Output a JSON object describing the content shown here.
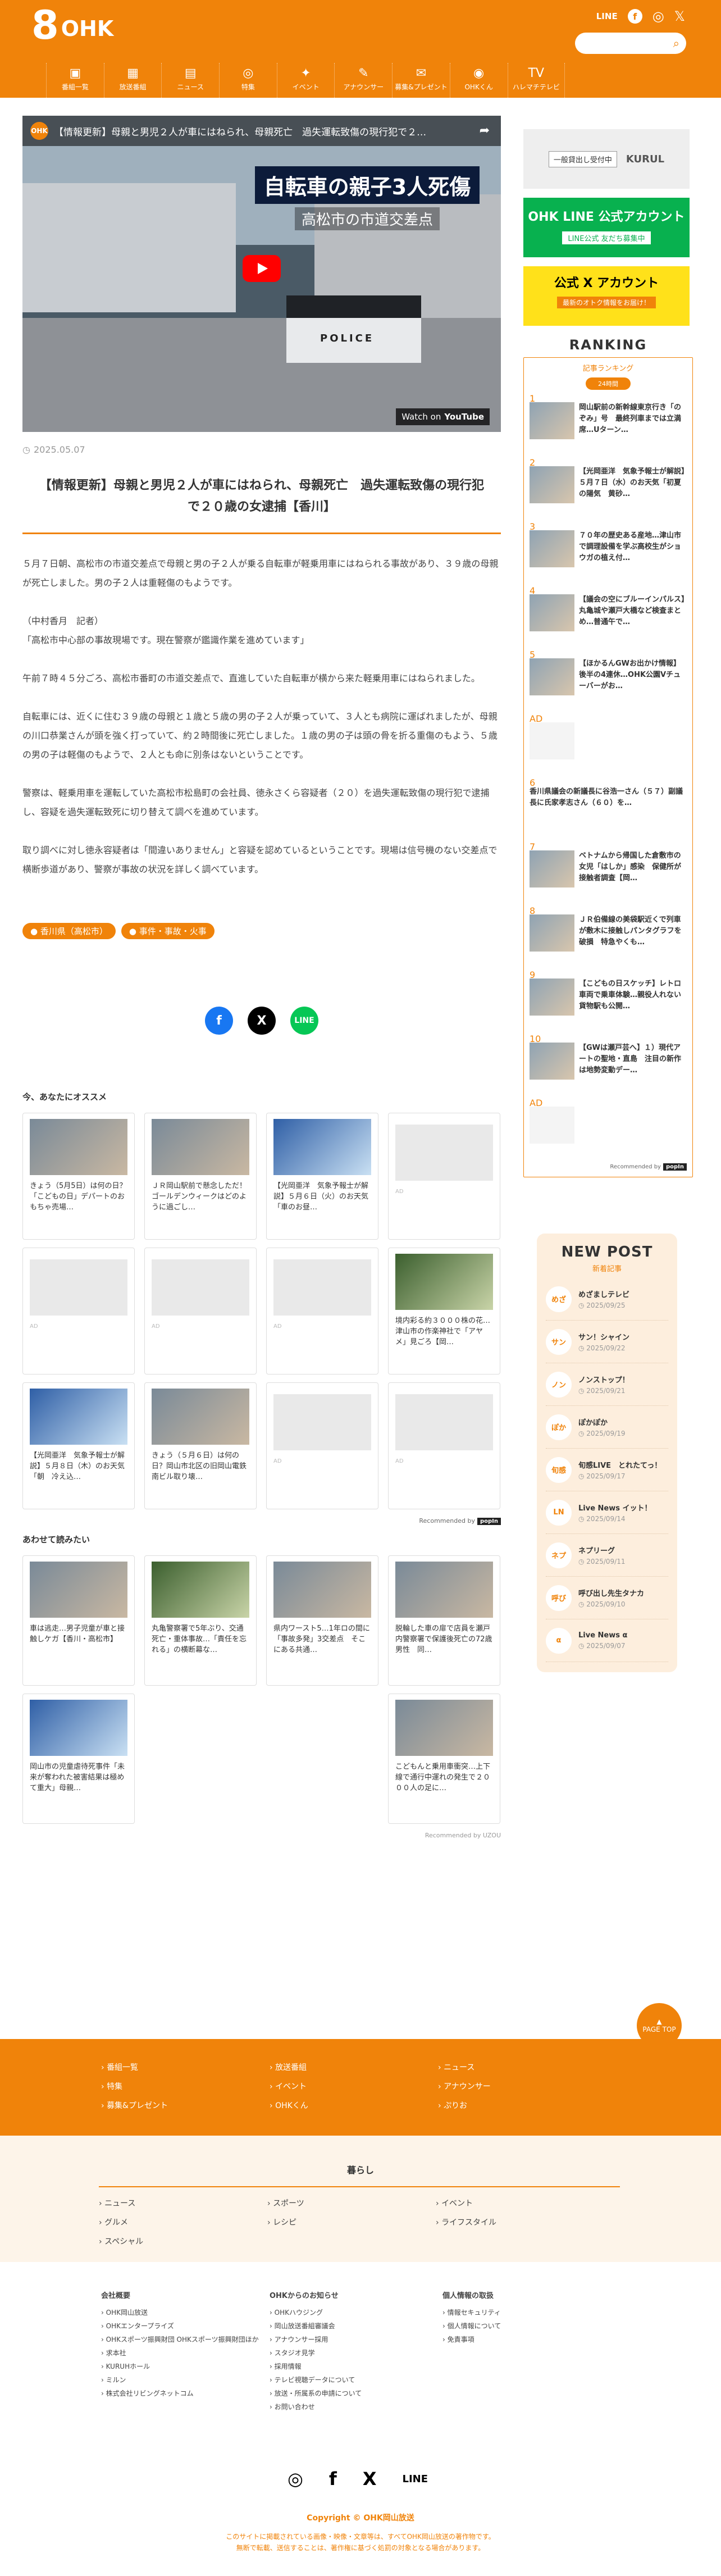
{
  "brand": {
    "logo_num": "8",
    "logo_text": "OHK"
  },
  "header": {
    "sns_line": "LINE",
    "search_placeholder": "",
    "nav": [
      {
        "icon": "▣",
        "label": "番組一覧"
      },
      {
        "icon": "▦",
        "label": "放送番組"
      },
      {
        "icon": "▤",
        "label": "ニュース"
      },
      {
        "icon": "◎",
        "label": "特集"
      },
      {
        "icon": "✦",
        "label": "イベント"
      },
      {
        "icon": "✎",
        "label": "アナウンサー"
      },
      {
        "icon": "✉",
        "label": "募集&プレゼント"
      },
      {
        "icon": "◉",
        "label": "OHKくん"
      },
      {
        "icon": "TV",
        "label": "ハレマチテレビ"
      }
    ]
  },
  "video": {
    "channel": "OHK",
    "title": "【情報更新】母親と男児２人が車にはねられ、母親死亡　過失運転致傷の現行犯で２…",
    "caption_big": "自転車の親子3人死傷",
    "caption_small": "高松市の市道交差点",
    "police": "POLICE",
    "watch_on": "Watch on",
    "youtube": "YouTube"
  },
  "article": {
    "date": "2025.05.07",
    "title": "【情報更新】母親と男児２人が車にはねられ、母親死亡　過失運転致傷の現行犯で２０歳の女逮捕【香川】",
    "paragraphs": [
      "５月７日朝、高松市の市道交差点で母親と男の子２人が乗る自転車が軽乗用車にはねられる事故があり、３９歳の母親が死亡しました。男の子２人は重軽傷のもようです。",
      "（中村香月　記者）\n「高松市中心部の事故現場です。現在警察が鑑識作業を進めています」",
      "午前７時４５分ごろ、高松市番町の市道交差点で、直進していた自転車が横から来た軽乗用車にはねられました。",
      "自転車には、近くに住む３９歳の母親と１歳と５歳の男の子２人が乗っていて、３人とも病院に運ばれましたが、母親の川口恭業さんが頭を強く打っていて、約２時間後に死亡しました。１歳の男の子は頭の骨を折る重傷のもよう、５歳の男の子は軽傷のもようで、２人とも命に別条はないということです。",
      "警察は、軽乗用車を運転していた高松市松島町の会社員、徳永さくら容疑者（２０）を過失運転致傷の現行犯で逮捕し、容疑を過失運転致死に切り替えて調べを進めています。",
      "取り調べに対し徳永容疑者は「間違いありません」と容疑を認めているということです。現場は信号機のない交差点で横断歩道があり、警察が事故の状況を詳しく調べています。"
    ],
    "tags": [
      "香川県（高松市）",
      "事件・事故・火事"
    ]
  },
  "share": {
    "fb": "f",
    "x": "X",
    "line": "LINE"
  },
  "recommend": {
    "heading": "今、あなたにオススメ",
    "cards": [
      {
        "text": "きょう（5月5日）は何の日？「こどもの日」デパートのおもちゃ売場…",
        "ad": false
      },
      {
        "text": "ＪＲ岡山駅前で懸念しただ！ゴールデンウィークはどのように過ごし…",
        "ad": false
      },
      {
        "text": "【光岡亜洋　気象予報士が解説】５月６日（火）のお天気「車のお昼…",
        "ad": false
      },
      {
        "text": "",
        "ad": true
      },
      {
        "text": "",
        "ad": true
      },
      {
        "text": "",
        "ad": true
      },
      {
        "text": "",
        "ad": true
      },
      {
        "text": "境内彩る約３０００株の花…津山市の作楽神社で「アヤメ」見ごろ【岡…",
        "ad": false
      },
      {
        "text": "【光岡亜洋　気象予報士が解説】５月８日（木）のお天気「朝　冷え込…",
        "ad": false
      },
      {
        "text": "きょう（５月６日）は何の日？岡山市北区の旧岡山電鉄南ビル取り壊…",
        "ad": false
      },
      {
        "text": "",
        "ad": true
      },
      {
        "text": "",
        "ad": true
      }
    ],
    "ad_label": "AD",
    "recommended_by": "Recommended by",
    "popin": "popIn"
  },
  "related": {
    "heading": "あわせて読みたい",
    "cards": [
      {
        "text": "車は逃走…男子児童が車と接触しケガ【香川・高松市】"
      },
      {
        "text": "丸亀警察署で5年ぶり、交通死亡・重体事故…「責任を忘れる」の横断幕な…"
      },
      {
        "text": "県内ワースト5…1年ロの間に「事故多発」3交差点　そこにある共通…"
      },
      {
        "text": "脱輪した車の扉で店員を瀬戸内警察署で保護後死亡の72歳男性　同…"
      },
      {
        "text": "岡山市の児童虐待死事件「未来が奪われた被害結果は極めて重大」母親…"
      },
      {
        "text": "こどもんと乗用車衝突…上下線で通行中運れの発生で２０００人の足に…"
      }
    ],
    "uzou": "Recommended by UZOU"
  },
  "side": {
    "banner1": {
      "label": "一般貸出し受付中",
      "brand": "KURUL"
    },
    "banner2": {
      "title": "OHK LINE 公式アカウント",
      "sub": "LINE公式 友だち募集中"
    },
    "banner3": {
      "title": "公式 X アカウント",
      "sub": "最新のオトク情報をお届け！"
    },
    "ranking": {
      "title": "RANKING",
      "sub": "記事ランキング",
      "pill": "24時間",
      "items": [
        {
          "num": "1",
          "text": "岡山駅前の新幹線東京行き「のぞみ」号　最終列車までは立満席…Uターン…",
          "img": true
        },
        {
          "num": "2",
          "text": "【光岡亜洋　気象予報士が解説】５月７日（水）のお天気「初夏の陽気　黄砂…",
          "img": true
        },
        {
          "num": "3",
          "text": "７０年の歴史ある産地…津山市で調理設備を学ぶ高校生がショウガの植え付…",
          "img": true
        },
        {
          "num": "4",
          "text": "【議会の空にブルーインパルス】丸亀城や瀬戸大橋など検査まとめ…普通午で…",
          "img": true
        },
        {
          "num": "5",
          "text": "【ほかるんGWお出かけ情報】後半の4連休…OHK公園Vチューバーがお…",
          "img": true
        },
        {
          "num": "AD",
          "text": "",
          "img": false
        },
        {
          "num": "6",
          "text": "香川県議会の新議長に谷浩一さん（５７）副議長に氏家孝志さん（６０）を…",
          "img": false
        },
        {
          "num": "7",
          "text": "ベトナムから帰国した倉敷市の女児「はしか」感染　保健所が接触者調査【岡…",
          "img": true
        },
        {
          "num": "8",
          "text": "ＪＲ伯備線の美袋駅近くで列車が敷木に接触しパンタグラフを破損　特急やくも…",
          "img": true
        },
        {
          "num": "9",
          "text": "【こどもの日スケッチ】レトロ車両で乗車体験…親役人れない貨物駅も公開…",
          "img": true
        },
        {
          "num": "10",
          "text": "【GWは瀬戸芸へ】１）現代アートの聖地・直島　注目の新作は地勢変動デー…",
          "img": true
        },
        {
          "num": "AD",
          "text": "",
          "img": false
        }
      ],
      "foot": "Recommended by",
      "popin": "popIn"
    },
    "newpost": {
      "title": "NEW POST",
      "sub": "新着記事",
      "items": [
        {
          "icon": "めざ",
          "name": "めざましテレビ",
          "date": "2025/09/25"
        },
        {
          "icon": "サン",
          "name": "サン！シャイン",
          "date": "2025/09/22"
        },
        {
          "icon": "ノン",
          "name": "ノンストップ！",
          "date": "2025/09/21"
        },
        {
          "icon": "ぽか",
          "name": "ぽかぽか",
          "date": "2025/09/19"
        },
        {
          "icon": "旬感",
          "name": "旬感LIVE　とれたてっ！",
          "date": "2025/09/17"
        },
        {
          "icon": "LN",
          "name": "Live News イット！",
          "date": "2025/09/14"
        },
        {
          "icon": "ネプ",
          "name": "ネプリーグ",
          "date": "2025/09/11"
        },
        {
          "icon": "呼び",
          "name": "呼び出し先生タナカ",
          "date": "2025/09/10"
        },
        {
          "icon": "α",
          "name": "Live News α",
          "date": "2025/09/07"
        }
      ]
    }
  },
  "footer": {
    "pagetop": "PAGE TOP",
    "band": [
      "番組一覧",
      "放送番組",
      "ニュース",
      "特集",
      "イベント",
      "アナウンサー",
      "募集&プレゼント",
      "OHKくん",
      "ぷりお"
    ],
    "kurashi_title": "暮らし",
    "kurashi": [
      "ニュース",
      "スポーツ",
      "イベント",
      "グルメ",
      "レシピ",
      "ライフスタイル",
      "スペシャル"
    ],
    "company": {
      "title": "会社概要",
      "items": [
        "OHK岡山放送",
        "OHKエンタープライズ",
        "OHKスポーツ振興財団 OHKスポーツ振興財団ほか",
        "求本社",
        "KURUHホール",
        "ミルン",
        "株式会社リビングネットコム"
      ]
    },
    "notice": {
      "title": "OHKからのお知らせ",
      "items": [
        "OHKハウジング",
        "岡山放送番組審議会",
        "アナウンサー採用",
        "スタジオ見学",
        "採用情報",
        "テレビ視聴データについて",
        "放送・所属系の申請について",
        "お問い合わせ"
      ]
    },
    "privacy": {
      "title": "個人情報の取扱",
      "items": [
        "情報セキュリティ",
        "個人情報について",
        "免責事項"
      ]
    },
    "sns": [
      "◎",
      "f",
      "X",
      "LINE"
    ],
    "copyright": "Copyright © OHK岡山放送",
    "legal1": "このサイトに掲載されている画像・映像・文章等は、すべてOHK岡山放送の著作物です。",
    "legal2": "無断で転載、送信することは、著作権に基づく処罰の対象となる場合があります。"
  }
}
